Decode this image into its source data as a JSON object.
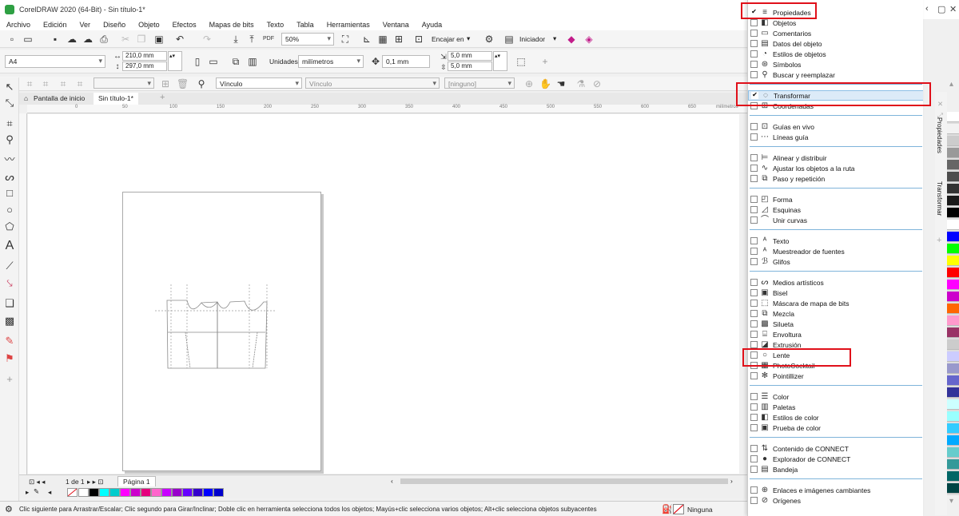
{
  "window": {
    "title": "CorelDRAW 2020 (64-Bit) - Sin título-1*"
  },
  "menu": [
    "Archivo",
    "Edición",
    "Ver",
    "Diseño",
    "Objeto",
    "Efectos",
    "Mapas de bits",
    "Texto",
    "Tabla",
    "Herramientas",
    "Ventana",
    "Ayuda"
  ],
  "toolbar": {
    "zoom": "50%",
    "snap_label": "Encajar en",
    "launch_label": "Iniciador"
  },
  "property_bar": {
    "page_size": "A4",
    "width": "210,0 mm",
    "height": "297,0 mm",
    "units_label": "Unidades:",
    "units_value": "milímetros",
    "nudge": "0,1 mm",
    "dup_x": "5,0 mm",
    "dup_y": "5,0 mm"
  },
  "third_bar": {
    "link1": "Vínculo",
    "link2": "Vínculo",
    "none": "[ninguno]"
  },
  "tabs": {
    "home": "Pantalla de inicio",
    "doc": "Sin título-1*"
  },
  "ruler": {
    "ticks": [
      "0",
      "50",
      "100",
      "150",
      "200",
      "250",
      "300",
      "350",
      "400",
      "450",
      "500",
      "550",
      "600",
      "650"
    ],
    "unit": "milímetros"
  },
  "page_nav": {
    "counter": "1 de 1",
    "page_tab": "Página 1"
  },
  "status": {
    "hint": "Clic siguiente para Arrastrar/Escalar; Clic segundo para Girar/Inclinar; Doble clic en herramienta selecciona todos los objetos; Mayús+clic selecciona varios objetos; Alt+clic selecciona objetos subyacentes",
    "fill": "Ninguna"
  },
  "docker_menu": [
    {
      "label": "Propiedades",
      "icon": "properties-icon",
      "checked": true
    },
    {
      "label": "Objetos",
      "icon": "objects-icon",
      "checked": false
    },
    {
      "label": "Comentarios",
      "icon": "comments-icon",
      "checked": false
    },
    {
      "label": "Datos del objeto",
      "icon": "object-data-icon",
      "checked": false
    },
    {
      "label": "Estilos de objetos",
      "icon": "object-styles-icon",
      "checked": false
    },
    {
      "label": "Símbolos",
      "icon": "symbols-icon",
      "checked": false
    },
    {
      "label": "Buscar y reemplazar",
      "icon": "find-replace-icon",
      "checked": false,
      "sep_after": true
    },
    {
      "label": "Transformar",
      "icon": "transform-icon",
      "checked": true,
      "hover": true
    },
    {
      "label": "Coordenadas",
      "icon": "coordinates-icon",
      "checked": false,
      "sep_after": true
    },
    {
      "label": "Guías en vivo",
      "icon": "live-guides-icon",
      "checked": false
    },
    {
      "label": "Líneas guía",
      "icon": "guidelines-icon",
      "checked": false,
      "sep_after": true
    },
    {
      "label": "Alinear y distribuir",
      "icon": "align-icon",
      "checked": false
    },
    {
      "label": "Ajustar los objetos a la ruta",
      "icon": "fit-path-icon",
      "checked": false
    },
    {
      "label": "Paso y repetición",
      "icon": "step-repeat-icon",
      "checked": false,
      "sep_after": true
    },
    {
      "label": "Forma",
      "icon": "shape-icon",
      "checked": false
    },
    {
      "label": "Esquinas",
      "icon": "corners-icon",
      "checked": false
    },
    {
      "label": "Unir curvas",
      "icon": "join-curves-icon",
      "checked": false,
      "sep_after": true
    },
    {
      "label": "Texto",
      "icon": "text-icon",
      "checked": false
    },
    {
      "label": "Muestreador de fuentes",
      "icon": "font-sampler-icon",
      "checked": false
    },
    {
      "label": "Glifos",
      "icon": "glyphs-icon",
      "checked": false,
      "sep_after": true
    },
    {
      "label": "Medios artísticos",
      "icon": "artistic-media-icon",
      "checked": false
    },
    {
      "label": "Bisel",
      "icon": "bevel-icon",
      "checked": false
    },
    {
      "label": "Máscara de mapa de bits",
      "icon": "bitmap-mask-icon",
      "checked": false
    },
    {
      "label": "Mezcla",
      "icon": "blend-icon",
      "checked": false
    },
    {
      "label": "Silueta",
      "icon": "contour-icon",
      "checked": false
    },
    {
      "label": "Envoltura",
      "icon": "envelope-icon",
      "checked": false
    },
    {
      "label": "Extrusión",
      "icon": "extrude-icon",
      "checked": false
    },
    {
      "label": "Lente",
      "icon": "lens-icon",
      "checked": false
    },
    {
      "label": "PhotoCocktail",
      "icon": "photococktail-icon",
      "checked": false
    },
    {
      "label": "Pointillizer",
      "icon": "pointillizer-icon",
      "checked": false,
      "sep_after": true
    },
    {
      "label": "Color",
      "icon": "color-icon",
      "checked": false
    },
    {
      "label": "Paletas",
      "icon": "palettes-icon",
      "checked": false
    },
    {
      "label": "Estilos de color",
      "icon": "color-styles-icon",
      "checked": false
    },
    {
      "label": "Prueba de color",
      "icon": "color-proof-icon",
      "checked": false,
      "sep_after": true
    },
    {
      "label": "Contenido de CONNECT",
      "icon": "connect-content-icon",
      "checked": false
    },
    {
      "label": "Explorador de CONNECT",
      "icon": "connect-browser-icon",
      "checked": false
    },
    {
      "label": "Bandeja",
      "icon": "tray-icon",
      "checked": false,
      "sep_after": true
    },
    {
      "label": "Enlaces e imágenes cambiantes",
      "icon": "links-icon",
      "checked": false
    },
    {
      "label": "Orígenes",
      "icon": "sources-icon",
      "checked": false
    }
  ],
  "side_tabs": [
    "Propiedades",
    "Transformar"
  ],
  "colors": {
    "accent_red": "#e0101a",
    "bottom_palette": [
      "#ffffff",
      "#000000",
      "#00ffff",
      "#00cccc",
      "#ff00ff",
      "#cc00cc",
      "#e6007e",
      "#ff66cc",
      "#c800ff",
      "#9900cc",
      "#6600ff",
      "#3300cc",
      "#0000ff",
      "#0000cc"
    ],
    "right_palette": [
      "#ffffff",
      "#f2f2f2",
      "#cccccc",
      "#999999",
      "#666666",
      "#4d4d4d",
      "#333333",
      "#1a1a1a",
      "#000000",
      "#ffffff",
      "#0000ff",
      "#00ff00",
      "#ffff00",
      "#ff0000",
      "#ff00ff",
      "#cc00cc",
      "#ff6600",
      "#ff99cc",
      "#993366",
      "#cccccc",
      "#ccccff",
      "#9999cc",
      "#6666cc",
      "#333399",
      "#ccffff",
      "#99ffff",
      "#33ccff",
      "#00aaff",
      "#66cccc",
      "#339999",
      "#006666",
      "#004444"
    ]
  }
}
